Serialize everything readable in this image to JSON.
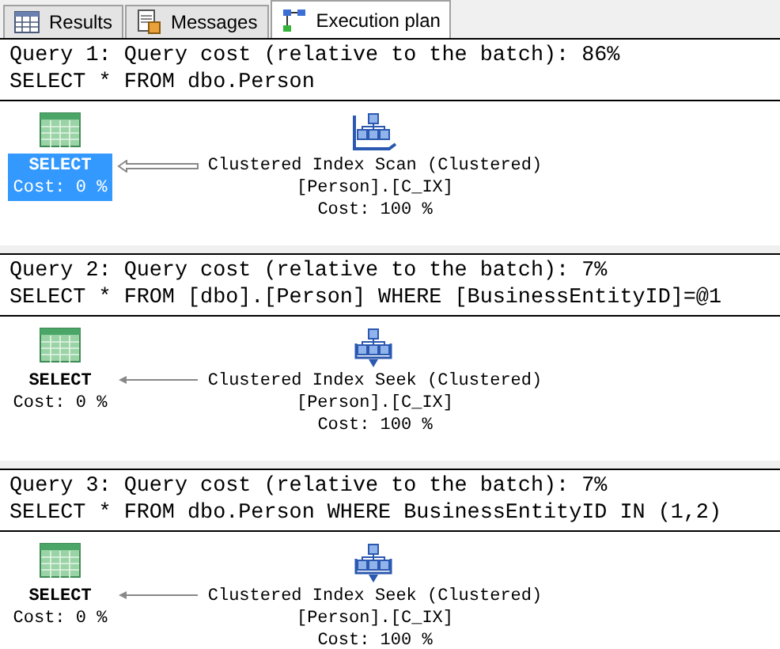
{
  "tabs": [
    {
      "label": "Results",
      "kind": "grid",
      "selected": false
    },
    {
      "label": "Messages",
      "kind": "messages",
      "selected": false
    },
    {
      "label": "Execution plan",
      "kind": "plan",
      "selected": true
    }
  ],
  "queries": [
    {
      "header": "Query 1: Query cost (relative to the batch): 86%",
      "sql": "SELECT * FROM dbo.Person",
      "root": {
        "label": "SELECT",
        "cost": "Cost: 0 %",
        "selected": true
      },
      "thick_arrow": true,
      "operator": {
        "kind": "scan",
        "name": "Clustered Index Scan (Clustered)",
        "object": "[Person].[C_IX]",
        "cost": "Cost: 100 %"
      }
    },
    {
      "header": "Query 2: Query cost (relative to the batch): 7%",
      "sql": "SELECT * FROM [dbo].[Person] WHERE [BusinessEntityID]=@1",
      "root": {
        "label": "SELECT",
        "cost": "Cost: 0 %",
        "selected": false
      },
      "thick_arrow": false,
      "operator": {
        "kind": "seek",
        "name": "Clustered Index Seek (Clustered)",
        "object": "[Person].[C_IX]",
        "cost": "Cost: 100 %"
      }
    },
    {
      "header": "Query 3: Query cost (relative to the batch): 7%",
      "sql": "SELECT * FROM dbo.Person WHERE BusinessEntityID IN (1,2)",
      "root": {
        "label": "SELECT",
        "cost": "Cost: 0 %",
        "selected": false
      },
      "thick_arrow": false,
      "operator": {
        "kind": "seek",
        "name": "Clustered Index Seek (Clustered)",
        "object": "[Person].[C_IX]",
        "cost": "Cost: 100 %"
      }
    }
  ]
}
